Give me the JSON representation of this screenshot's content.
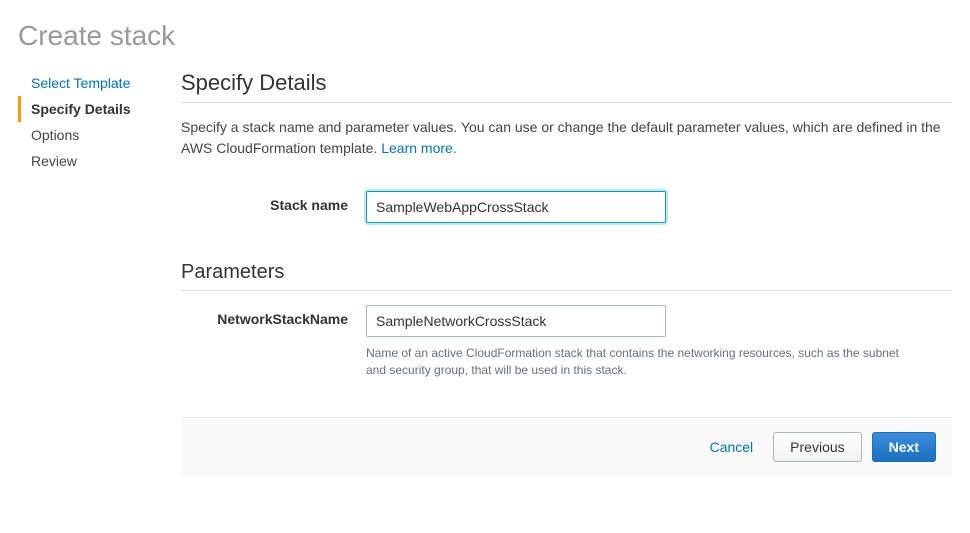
{
  "page": {
    "title": "Create stack"
  },
  "sidebar": {
    "items": [
      {
        "label": "Select Template"
      },
      {
        "label": "Specify Details"
      },
      {
        "label": "Options"
      },
      {
        "label": "Review"
      }
    ]
  },
  "main": {
    "heading": "Specify Details",
    "description_prefix": "Specify a stack name and parameter values. You can use or change the default parameter values, which are defined in the AWS CloudFormation template. ",
    "learn_more": "Learn more.",
    "stack_name": {
      "label": "Stack name",
      "value": "SampleWebAppCrossStack"
    },
    "parameters_heading": "Parameters",
    "network_stack": {
      "label": "NetworkStackName",
      "value": "SampleNetworkCrossStack",
      "help": "Name of an active CloudFormation stack that contains the networking resources, such as the subnet and security group, that will be used in this stack."
    }
  },
  "footer": {
    "cancel": "Cancel",
    "previous": "Previous",
    "next": "Next"
  }
}
